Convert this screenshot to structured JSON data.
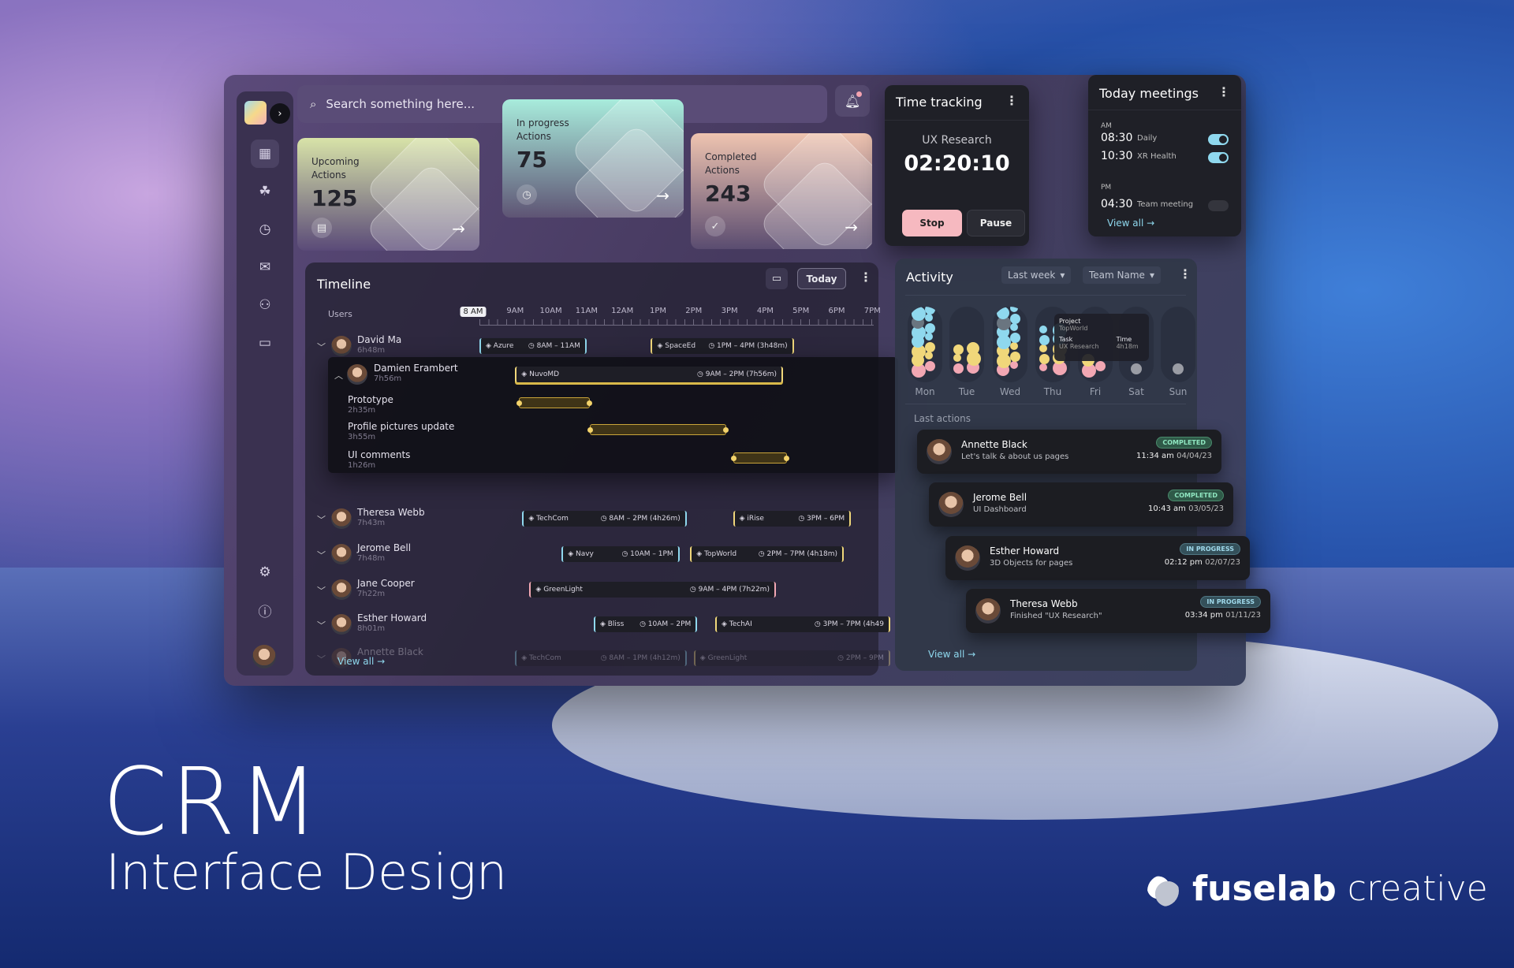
{
  "search": {
    "placeholder": "Search something here..."
  },
  "sidebar": {
    "icons": [
      "dashboard-icon",
      "network-icon",
      "clock-icon",
      "mail-icon",
      "users-icon",
      "calendar-icon"
    ],
    "bottom_icons": [
      "settings-icon",
      "info-icon"
    ]
  },
  "cards": [
    {
      "label1": "Upcoming",
      "label2": "Actions",
      "value": "125",
      "icon": "document-icon",
      "colors": [
        "#d8e3a8",
        "#5a4a78"
      ]
    },
    {
      "label1": "In progress",
      "label2": "Actions",
      "value": "75",
      "icon": "clock-icon",
      "colors": [
        "#a8ecdc",
        "#5e5474"
      ]
    },
    {
      "label1": "Completed",
      "label2": "Actions",
      "value": "243",
      "icon": "check-icon",
      "colors": [
        "#efc4b0",
        "#5a4c70"
      ]
    }
  ],
  "time_tracking": {
    "title": "Time tracking",
    "task": "UX Research",
    "timer": "02:20:10",
    "stop": "Stop",
    "pause": "Pause"
  },
  "meetings": {
    "title": "Today meetings",
    "am": "AM",
    "pm": "PM",
    "items": [
      {
        "time": "08:30",
        "name": "Daily",
        "enabled": true
      },
      {
        "time": "10:30",
        "name": "XR Health",
        "enabled": true
      },
      {
        "time": "04:30",
        "name": "Team meeting",
        "enabled": false
      }
    ],
    "view_all": "View all →"
  },
  "timeline": {
    "title": "Timeline",
    "today": "Today",
    "users_label": "Users",
    "view_all": "View all →",
    "hours": [
      "8 AM",
      "9AM",
      "10AM",
      "11AM",
      "12AM",
      "1PM",
      "2PM",
      "3PM",
      "4PM",
      "5PM",
      "6PM",
      "7PM"
    ],
    "rows": [
      {
        "name": "David Ma",
        "total": "6h48m",
        "expanded": false,
        "bars": [
          {
            "project": "Azure",
            "time": "8AM – 11AM",
            "start": 8,
            "end": 11,
            "color": "#8fd8ee"
          },
          {
            "project": "SpaceEd",
            "time": "1PM – 4PM (3h48m)",
            "start": 12.8,
            "end": 16.8,
            "color": "#f0d77a"
          }
        ]
      },
      {
        "name": "Damien Erambert",
        "total": "7h56m",
        "expanded": true,
        "bars": [
          {
            "project": "NuvoMD",
            "time": "9AM – 2PM (7h56m)",
            "start": 9,
            "end": 16.5,
            "color": "#f0d77a"
          }
        ],
        "tasks": [
          {
            "name": "Prototype",
            "total": "2h35m",
            "start": 9.1,
            "end": 11.1
          },
          {
            "name": "Profile pictures update",
            "total": "3h55m",
            "start": 11.1,
            "end": 14.9
          },
          {
            "name": "UI comments",
            "total": "1h26m",
            "start": 15.1,
            "end": 16.6
          }
        ]
      },
      {
        "name": "Theresa Webb",
        "total": "7h43m",
        "expanded": false,
        "bars": [
          {
            "project": "TechCom",
            "time": "8AM – 2PM (4h26m)",
            "start": 9.2,
            "end": 13.8,
            "color": "#8fd8ee"
          },
          {
            "project": "iRise",
            "time": "3PM – 6PM",
            "start": 15.1,
            "end": 18.4,
            "color": "#f0d77a"
          }
        ]
      },
      {
        "name": "Jerome Bell",
        "total": "7h48m",
        "expanded": false,
        "bars": [
          {
            "project": "Navy",
            "time": "10AM – 1PM",
            "start": 10.3,
            "end": 13.6,
            "color": "#8fd8ee"
          },
          {
            "project": "TopWorld",
            "time": "2PM – 7PM (4h18m)",
            "start": 13.9,
            "end": 18.2,
            "color": "#f0d77a"
          }
        ]
      },
      {
        "name": "Jane Cooper",
        "total": "7h22m",
        "expanded": false,
        "bars": [
          {
            "project": "GreenLight",
            "time": "9AM – 4PM (7h22m)",
            "start": 9.4,
            "end": 16.3,
            "color": "#f2a7b3"
          }
        ]
      },
      {
        "name": "Esther Howard",
        "total": "8h01m",
        "expanded": false,
        "bars": [
          {
            "project": "Bliss",
            "time": "10AM – 2PM",
            "start": 11.2,
            "end": 14.1,
            "color": "#8fd8ee"
          },
          {
            "project": "TechAI",
            "time": "3PM – 7PM (4h49",
            "start": 14.6,
            "end": 19.5,
            "color": "#f0d77a"
          }
        ]
      },
      {
        "name": "Annette Black",
        "total": "",
        "expanded": false,
        "faded": true,
        "bars": [
          {
            "project": "TechCom",
            "time": "8AM – 1PM (4h12m)",
            "start": 9,
            "end": 13.8,
            "color": "#8fd8ee"
          },
          {
            "project": "GreenLight",
            "time": "2PM – 9PM",
            "start": 14,
            "end": 19.5,
            "color": "#f0d77a"
          }
        ]
      }
    ]
  },
  "activity": {
    "title": "Activity",
    "filter_period": "Last week",
    "filter_team": "Team Name",
    "days": [
      "Mon",
      "Tue",
      "Wed",
      "Thu",
      "Fri",
      "Sat",
      "Sun"
    ],
    "levels": [
      14,
      6,
      14,
      10,
      3,
      0,
      0
    ],
    "colors": {
      "cyan": "#8fd8ee",
      "yellow": "#f0d77a",
      "pink": "#f2a7b3",
      "muted": "#6a7580"
    },
    "tooltip": {
      "project_label": "Project",
      "project": "TopWorld",
      "task_label": "Task",
      "task": "UX Research",
      "time_label": "Time",
      "time": "4h18m"
    },
    "last_actions_label": "Last actions",
    "last_actions": [
      {
        "name": "Annette Black",
        "desc": "Let's talk & about us pages",
        "status": "COMPLETED",
        "time": "11:34 am",
        "date": "04/04/23"
      },
      {
        "name": "Jerome Bell",
        "desc": "UI Dashboard",
        "status": "COMPLETED",
        "time": "10:43 am",
        "date": "03/05/23"
      },
      {
        "name": "Esther Howard",
        "desc": "3D Objects for pages",
        "status": "IN PROGRESS",
        "time": "02:12 pm",
        "date": "02/07/23"
      },
      {
        "name": "Theresa Webb",
        "desc": "Finished \"UX Research\"",
        "status": "IN PROGRESS",
        "time": "03:34 pm",
        "date": "01/11/23"
      }
    ],
    "view_all": "View all →"
  },
  "hero": {
    "title": "CRM",
    "subtitle": "Interface Design",
    "brand_bold": "fuselab",
    "brand_light": " creative"
  }
}
